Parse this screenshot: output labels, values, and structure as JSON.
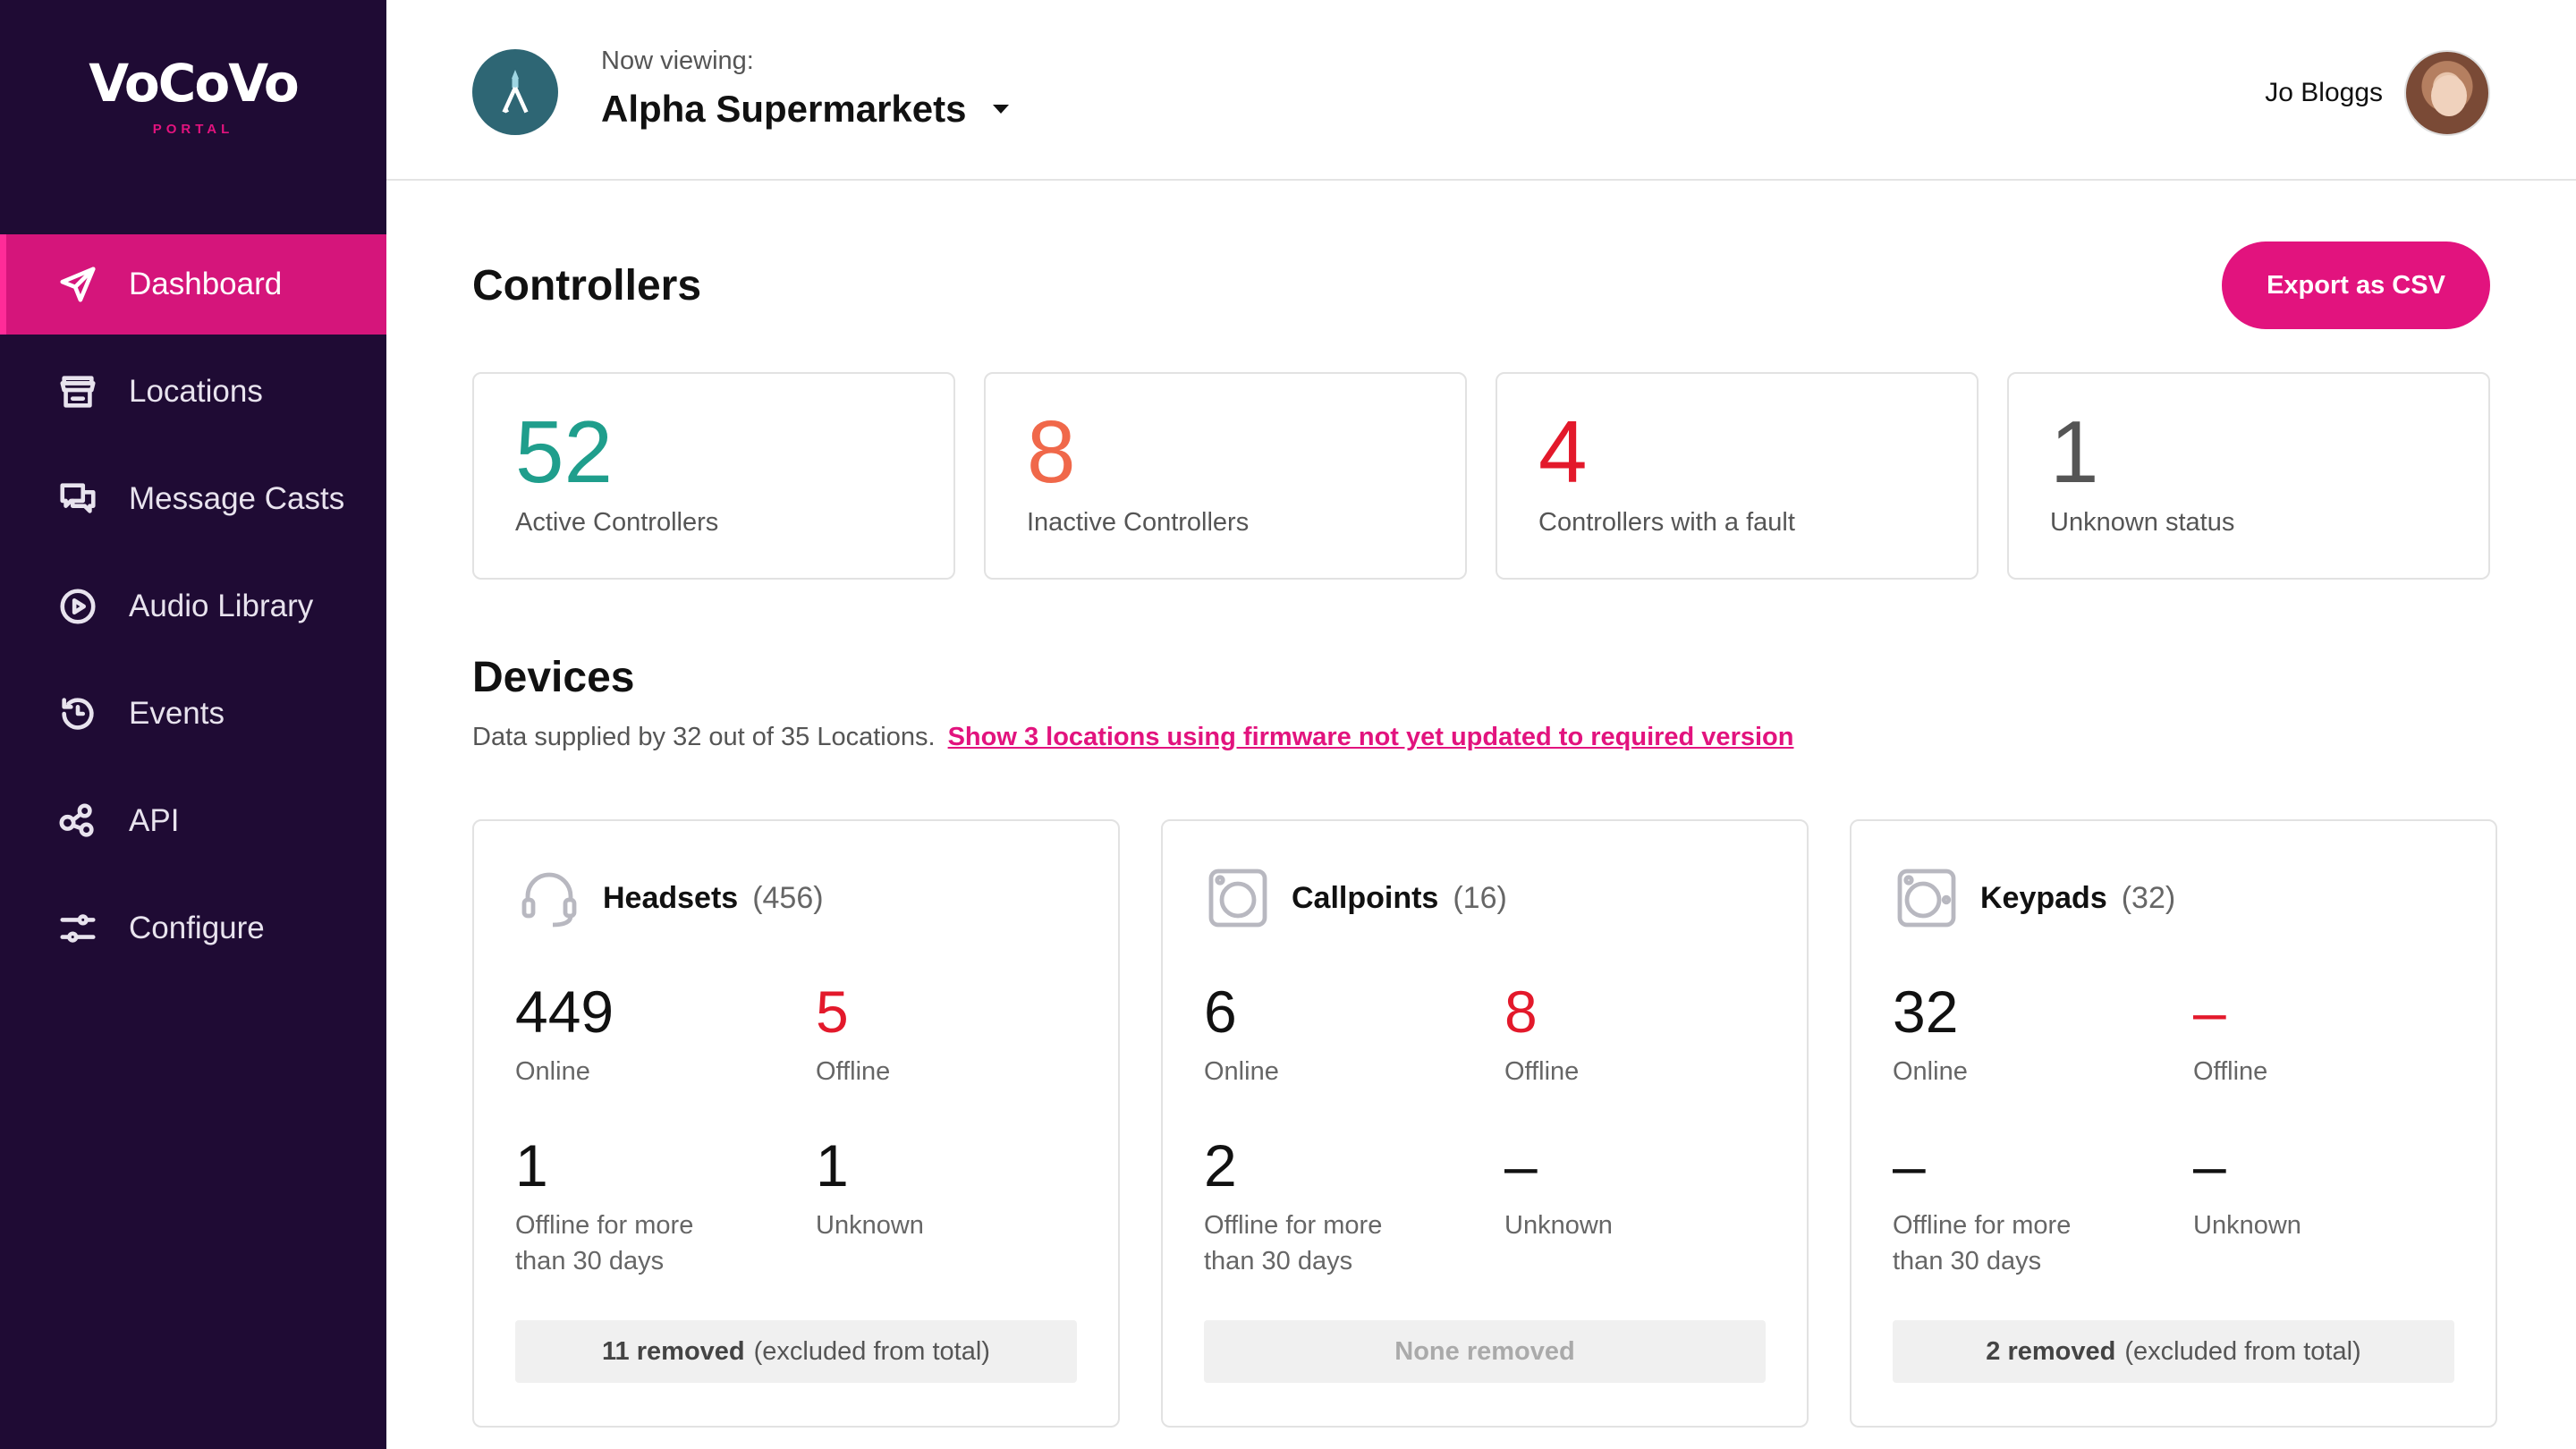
{
  "brand": {
    "logo_text": "VoCoVo",
    "logo_sub": "PORTAL",
    "accent": "#e2137e",
    "sidebar_bg": "#1f0b34"
  },
  "sidebar": {
    "items": [
      {
        "label": "Dashboard",
        "icon": "send-arrow-icon",
        "active": true
      },
      {
        "label": "Locations",
        "icon": "store-icon"
      },
      {
        "label": "Message Casts",
        "icon": "messages-icon"
      },
      {
        "label": "Audio Library",
        "icon": "play-circle-icon"
      },
      {
        "label": "Events",
        "icon": "history-clock-icon"
      },
      {
        "label": "API",
        "icon": "api-nodes-icon"
      },
      {
        "label": "Configure",
        "icon": "sliders-icon"
      }
    ]
  },
  "header": {
    "now_viewing": "Now viewing:",
    "org_name": "Alpha Supermarkets",
    "user_name": "Jo Bloggs"
  },
  "controllers": {
    "title": "Controllers",
    "export_label": "Export as CSV",
    "cards": [
      {
        "value": "52",
        "label": "Active Controllers",
        "color": "#1f9e8c"
      },
      {
        "value": "8",
        "label": "Inactive Controllers",
        "color": "#f0684a"
      },
      {
        "value": "4",
        "label": "Controllers with a fault",
        "color": "#e3192b"
      },
      {
        "value": "1",
        "label": "Unknown status",
        "color": "#555555"
      }
    ]
  },
  "devices": {
    "title": "Devices",
    "note": "Data supplied by 32 out of 35 Locations.",
    "link": "Show 3 locations using firmware not yet updated to required version",
    "cards": [
      {
        "name": "Headsets",
        "count": "(456)",
        "icon": "headset-icon",
        "online": "449",
        "online_label": "Online",
        "offline": "5",
        "offline_label": "Offline",
        "offline30": "1",
        "offline30_label": "Offline for more than 30 days",
        "unknown": "1",
        "unknown_label": "Unknown",
        "removed_bold": "11 removed",
        "removed_rest": "(excluded from total)"
      },
      {
        "name": "Callpoints",
        "count": "(16)",
        "icon": "callpoint-icon",
        "online": "6",
        "online_label": "Online",
        "offline": "8",
        "offline_label": "Offline",
        "offline30": "2",
        "offline30_label": "Offline for more than 30 days",
        "unknown": "–",
        "unknown_label": "Unknown",
        "removed_none": "None removed"
      },
      {
        "name": "Keypads",
        "count": "(32)",
        "icon": "keypad-icon",
        "online": "32",
        "online_label": "Online",
        "offline": "–",
        "offline_label": "Offline",
        "offline30": "–",
        "offline30_label": "Offline for more than 30 days",
        "unknown": "–",
        "unknown_label": "Unknown",
        "removed_bold": "2 removed",
        "removed_rest": "(excluded from total)"
      }
    ],
    "offline_color": "#e3192b"
  }
}
